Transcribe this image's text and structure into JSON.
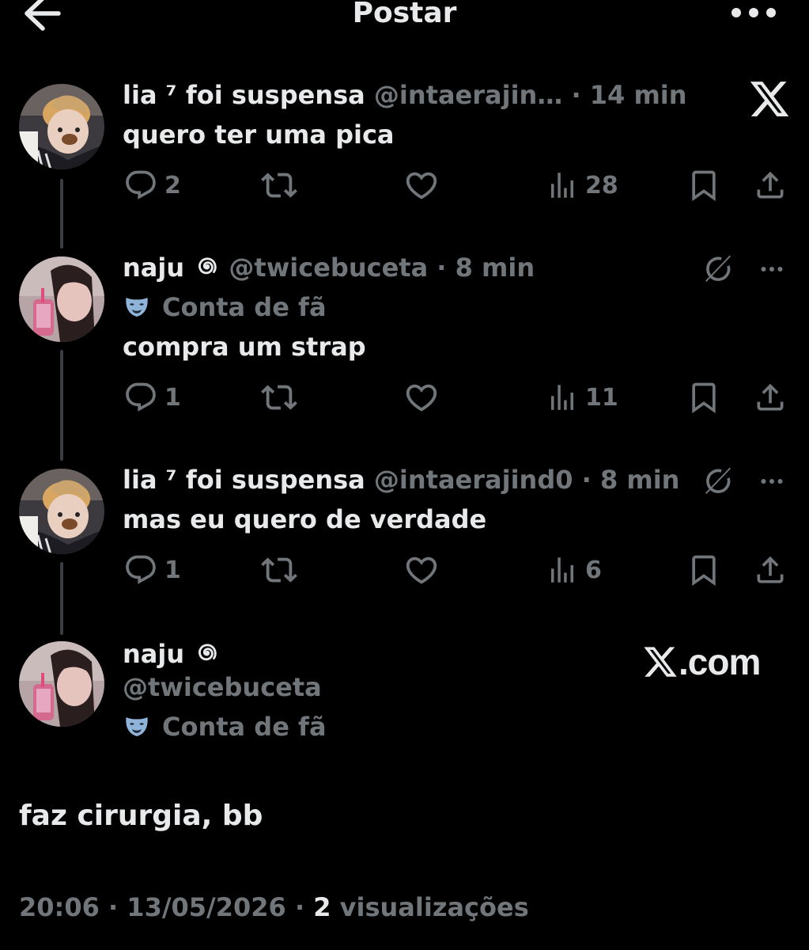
{
  "header": {
    "title": "Postar",
    "back_icon": "arrow-left-icon",
    "more_icon": "more-horizontal-icon"
  },
  "thread": [
    {
      "name": "lia ⁷ foi suspensa",
      "handle": "@intaerajin…",
      "dot": "·",
      "time": "14 min",
      "text": "quero ter uma pica",
      "replies": "2",
      "views": "28",
      "side_icon": "x-logo-icon"
    },
    {
      "name": "naju",
      "name_emoji": "🌀",
      "handle": "@twicebuceta",
      "dot": "·",
      "time": "8 min",
      "badge": "Conta de fã",
      "text": "compra um strap",
      "replies": "1",
      "views": "11",
      "side_icon": "grok-icon"
    },
    {
      "name": "lia ⁷ foi suspensa",
      "handle": "@intaerajind0",
      "dot": "·",
      "time": "8 min",
      "text": "mas eu quero de verdade",
      "replies": "1",
      "views": "6",
      "side_icon": "grok-icon"
    }
  ],
  "main_post": {
    "name": "naju",
    "name_emoji": "🌀",
    "handle": "@twicebuceta",
    "badge": "Conta de fã",
    "text": "faz cirurgia, bb",
    "time": "20:06",
    "sep1": "·",
    "date": "13/05/2026",
    "sep2": "·",
    "views_count": "2",
    "views_label": "visualizações"
  },
  "watermark": {
    "text": ".com",
    "icon": "x-logo-icon"
  },
  "colors": {
    "background": "#000000",
    "primary_text": "#e7e9ea",
    "secondary_text": "#71767b"
  }
}
